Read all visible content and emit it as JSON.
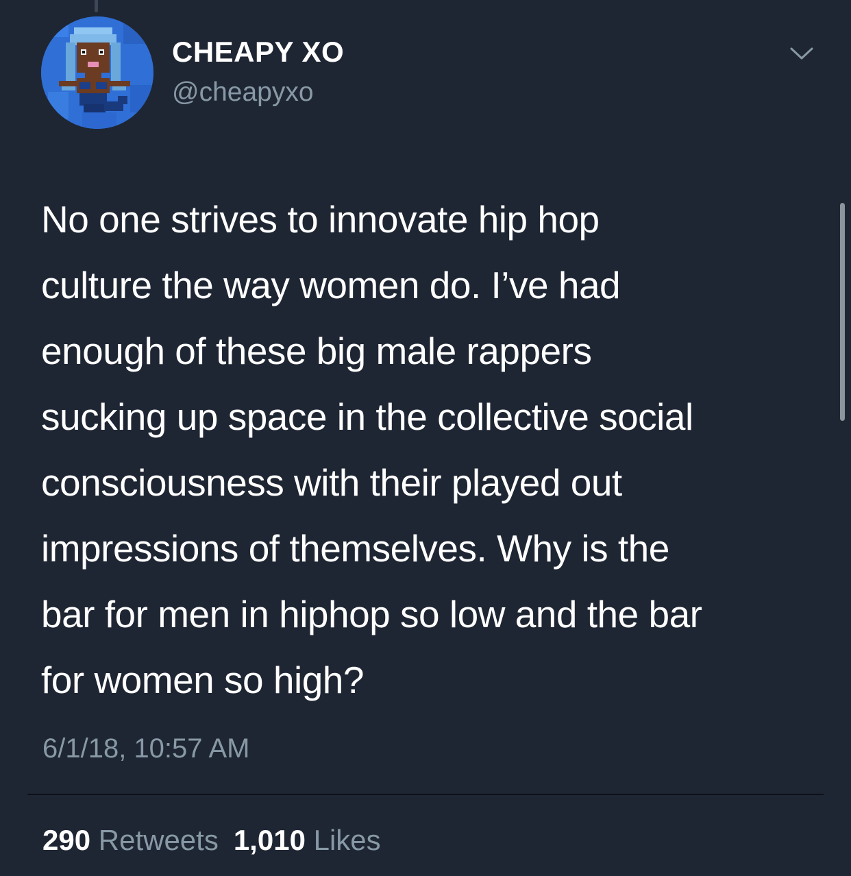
{
  "tweet": {
    "author": {
      "display_name": "CHEAPY XO",
      "handle": "@cheapyxo",
      "avatar_icon": "pixel-mermaid-avatar"
    },
    "menu_icon": "chevron-down-icon",
    "text": "No one strives to innovate hip hop\nculture the way women do. I’ve had\nenough of these big male rappers\nsucking up space in the collective social\nconsciousness with their played out\nimpressions of themselves. Why is the\nbar for men in hiphop so low and the bar\nfor women so high?",
    "timestamp": "6/1/18, 10:57 AM",
    "stats": {
      "retweets_count": "290",
      "retweets_label": "Retweets",
      "likes_count": "1,010",
      "likes_label": "Likes"
    }
  },
  "colors": {
    "background": "#1f2633",
    "primary_text": "#ffffff",
    "secondary_text": "#8899a6"
  }
}
